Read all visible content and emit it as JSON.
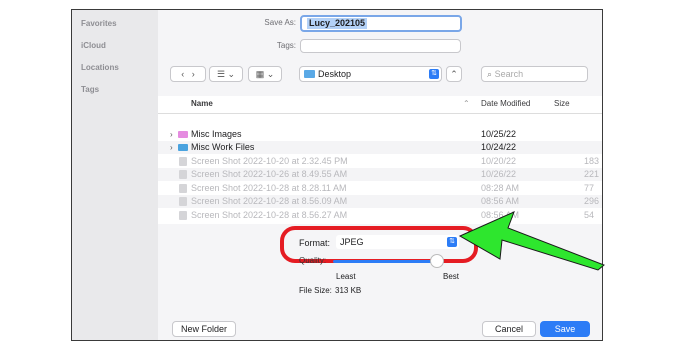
{
  "sidebar": {
    "items": [
      "Favorites",
      "iCloud",
      "Locations",
      "Tags"
    ]
  },
  "form": {
    "save_as_label": "Save As:",
    "save_as_value": "Lucy_202105",
    "tags_label": "Tags:"
  },
  "toolbar": {
    "back_icon": "chevron-left",
    "forward_icon": "chevron-right",
    "location": "Desktop",
    "search_placeholder": "Search"
  },
  "columns": {
    "name": "Name",
    "date": "Date Modified",
    "size": "Size"
  },
  "files": [
    {
      "name": "Misc Images",
      "date": "10/25/22",
      "size": "",
      "type": "folder",
      "color": "#e58ce0"
    },
    {
      "name": "Misc Work Files",
      "date": "10/24/22",
      "size": "",
      "type": "folder",
      "color": "#4aa3df"
    },
    {
      "name": "Screen Shot 2022-10-20 at 2.32.45 PM",
      "date": "10/20/22",
      "size": "183",
      "type": "image"
    },
    {
      "name": "Screen Shot 2022-10-26 at 8.49.55 AM",
      "date": "10/26/22",
      "size": "221",
      "type": "image"
    },
    {
      "name": "Screen Shot 2022-10-28 at 8.28.11 AM",
      "date": "08:28 AM",
      "size": "77",
      "type": "image"
    },
    {
      "name": "Screen Shot 2022-10-28 at 8.56.09 AM",
      "date": "08:56 AM",
      "size": "296",
      "type": "image"
    },
    {
      "name": "Screen Shot 2022-10-28 at 8.56.27 AM",
      "date": "08:56 AM",
      "size": "54",
      "type": "image"
    }
  ],
  "options": {
    "format_label": "Format:",
    "format_value": "JPEG",
    "quality_label": "Quality:",
    "quality_level": 0.93,
    "least_label": "Least",
    "best_label": "Best",
    "file_size_label": "File Size:",
    "file_size_value": "313 KB"
  },
  "buttons": {
    "new_folder": "New Folder",
    "cancel": "Cancel",
    "save": "Save"
  },
  "colors": {
    "accent": "#2c7cf6",
    "highlight": "#e51c23",
    "arrow": "#2ee62e"
  }
}
